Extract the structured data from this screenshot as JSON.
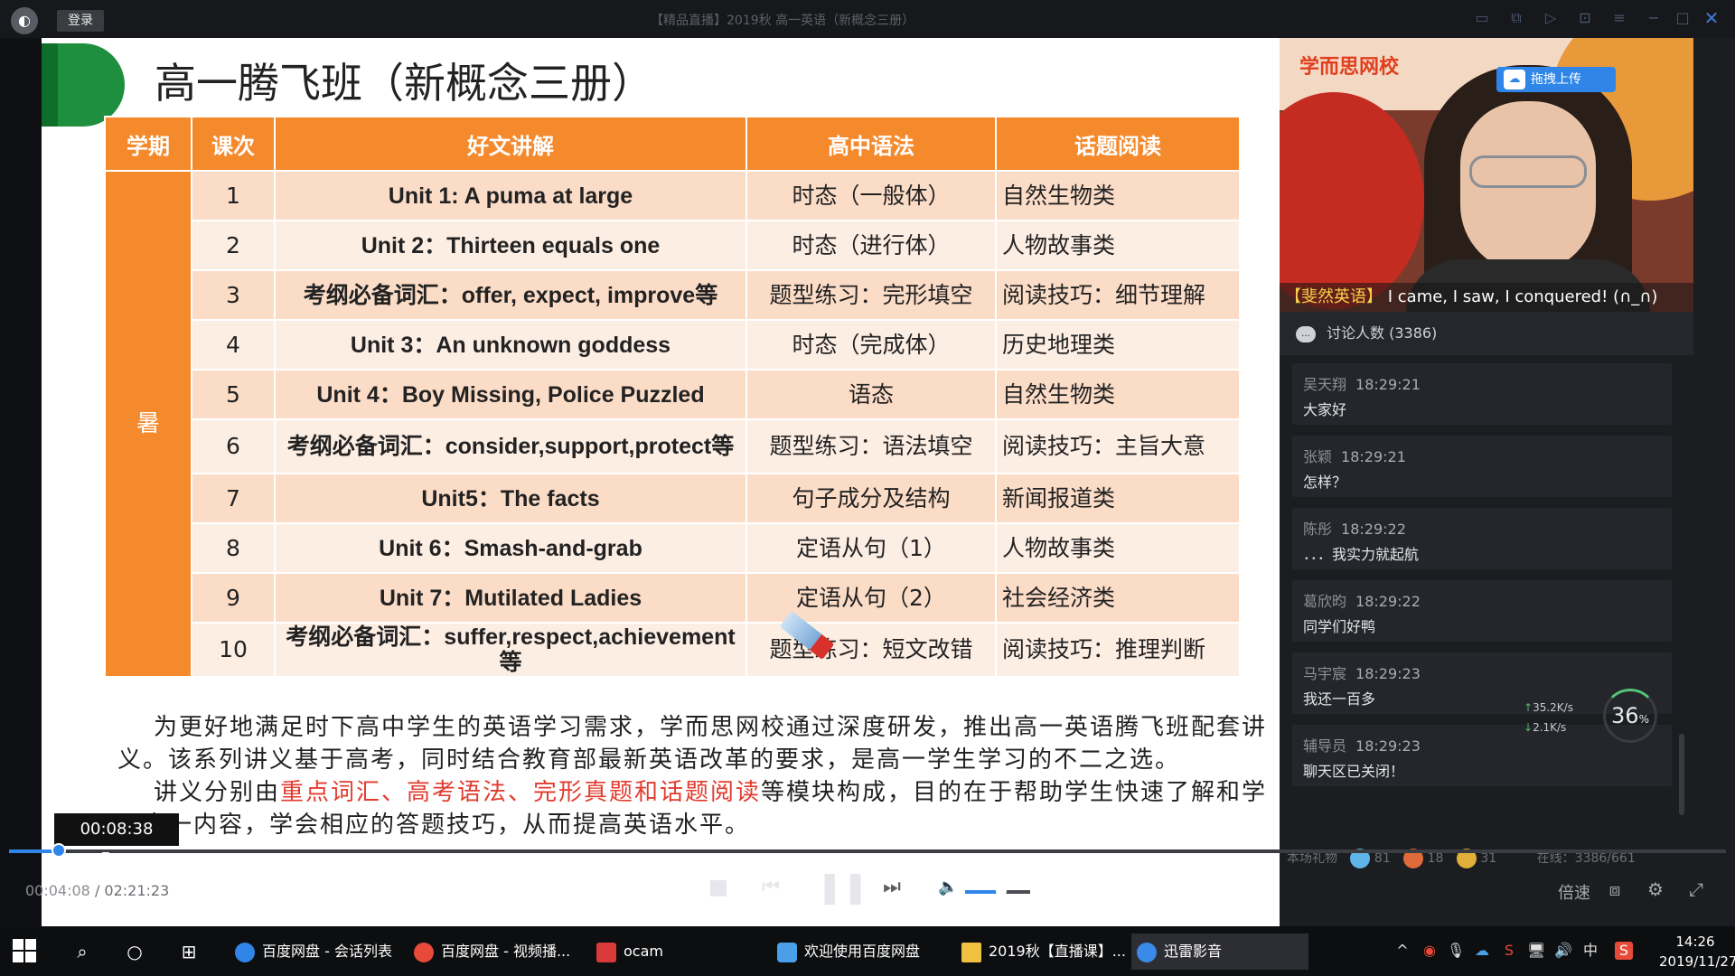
{
  "window": {
    "login_label": "登录",
    "title": "【精品直播】2019秋 高一英语（新概念三册）",
    "logo_glyph": "◐"
  },
  "slide": {
    "title": "高一腾飞班（新概念三册）",
    "table": {
      "headers": [
        "学期",
        "课次",
        "好文讲解",
        "高中语法",
        "话题阅读"
      ],
      "term": "暑",
      "rows": [
        {
          "n": "1",
          "text": "Unit 1: A puma at large",
          "grammar": "时态（一般体）",
          "topic": "自然生物类"
        },
        {
          "n": "2",
          "text": "Unit 2：Thirteen equals one",
          "grammar": "时态（进行体）",
          "topic": "人物故事类"
        },
        {
          "n": "3",
          "text": "考纲必备词汇：offer, expect, improve等",
          "grammar": "题型练习：完形填空",
          "topic": "阅读技巧：细节理解"
        },
        {
          "n": "4",
          "text": "Unit 3：An unknown goddess",
          "grammar": "时态（完成体）",
          "topic": "历史地理类"
        },
        {
          "n": "5",
          "text": "Unit 4：Boy Missing, Police Puzzled",
          "grammar": "语态",
          "topic": "自然生物类"
        },
        {
          "n": "6",
          "text": "考纲必备词汇：consider,support,protect等",
          "grammar": "题型练习：语法填空",
          "topic": "阅读技巧：主旨大意"
        },
        {
          "n": "7",
          "text": "Unit5：The facts",
          "grammar": "句子成分及结构",
          "topic": "新闻报道类"
        },
        {
          "n": "8",
          "text": "Unit 6：Smash-and-grab",
          "grammar": "定语从句（1）",
          "topic": "人物故事类"
        },
        {
          "n": "9",
          "text": "Unit 7：Mutilated Ladies",
          "grammar": "定语从句（2）",
          "topic": "社会经济类"
        },
        {
          "n": "10",
          "text": "考纲必备词汇：suffer,respect,achievement等",
          "grammar": "题型练习：短文改错",
          "topic": "阅读技巧：推理判断"
        }
      ]
    },
    "para1": "为更好地满足时下高中学生的英语学习需求，学而思网校通过深度研发，推出高一英语腾飞班配套讲义。该系列讲义基于高考，同时结合教育部最新英语改革的要求，是高一学生学习的不二之选。",
    "para2_pre": "讲义分别由",
    "para2_hl": "重点词汇、高考语法、完形真题和话题阅读",
    "para2_post": "等模块构成，目的在于帮助学生快速了解和学习高一内容，学会相应的答题技巧，从而提高英语水平。"
  },
  "video": {
    "brand": "学而思网校",
    "upload_label": "拖拽上传",
    "subtitle_tag": "【斐然英语】",
    "subtitle_text": "I came, I saw, I conquered! (∩_∩)"
  },
  "chat": {
    "header": "讨论人数 (3386)",
    "messages": [
      {
        "name": "吴天翔",
        "time": "18:29:21",
        "text": "大家好"
      },
      {
        "name": "张颖",
        "time": "18:29:21",
        "text": "怎样？"
      },
      {
        "name": "陈彤",
        "time": "18:29:22",
        "text": "．．．我实力就起航"
      },
      {
        "name": "葛欣昀",
        "time": "18:29:22",
        "text": "同学们好鸭"
      },
      {
        "name": "马宇宸",
        "time": "18:29:23",
        "text": "我还一百多"
      },
      {
        "name": "辅导员",
        "time": "18:29:23",
        "text": "聊天区已关闭！"
      }
    ],
    "gift_label": "本场礼物",
    "gifts": [
      {
        "count": "81",
        "color": "#5fb4e8"
      },
      {
        "count": "18",
        "color": "#e06a3a"
      },
      {
        "count": "31",
        "color": "#e0b03a"
      }
    ],
    "online_label": "在线：3386/661"
  },
  "net_speed": {
    "up": "35.2K/s",
    "down": "2.1K/s",
    "percent": "36",
    "percent_unit": "%"
  },
  "player": {
    "hover_time": "00:08:38",
    "current_time": "00:04:08",
    "total_time": "02:21:23",
    "progress_percent": 2.9,
    "volume_percent": 55,
    "speed_label": "倍速"
  },
  "taskbar": {
    "tasks": [
      {
        "label": "百度网盘 - 会话列表",
        "color": "#2f86e8"
      },
      {
        "label": "百度网盘 - 视频播...",
        "color": "#e84a3a"
      },
      {
        "label": "ocam",
        "color": "#d83a3a"
      },
      {
        "label": "欢迎使用百度网盘",
        "color": "#4aa0e8"
      },
      {
        "label": "2019秋【直播课】...",
        "color": "#f0c040"
      },
      {
        "label": "迅雷影音",
        "color": "#3a8ae8"
      }
    ],
    "clock_time": "14:26",
    "clock_date": "2019/11/27",
    "ime": "中"
  }
}
